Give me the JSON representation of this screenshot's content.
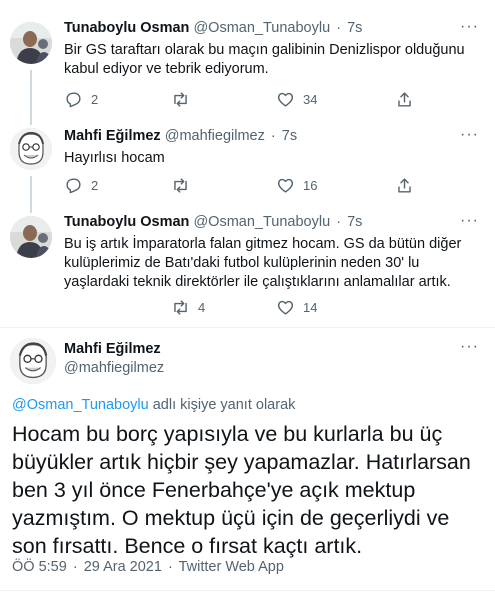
{
  "tweets": [
    {
      "name": "Tunaboylu Osman",
      "handle": "@Osman_Tunaboylu",
      "time": "7s",
      "text": "Bir GS taraftarı olarak bu maçın galibinin Denizlispor olduğunu kabul ediyor ve tebrik ediyorum.",
      "replies": "2",
      "retweets": "",
      "likes": "34"
    },
    {
      "name": "Mahfi Eğilmez",
      "handle": "@mahfiegilmez",
      "time": "7s",
      "text": "Hayırlısı hocam",
      "replies": "2",
      "retweets": "",
      "likes": "16"
    },
    {
      "name": "Tunaboylu Osman",
      "handle": "@Osman_Tunaboylu",
      "time": "7s",
      "text": "Bu iş artık İmparatorla falan gitmez hocam. GS da bütün diğer kulüplerimiz de Batı'daki futbol kulüplerinin neden 30' lu yaşlardaki teknik direktörler ile çalıştıklarını anlamalılar artık.",
      "replies": "",
      "retweets": "4",
      "likes": "14"
    }
  ],
  "main_tweet": {
    "name": "Mahfi Eğilmez",
    "handle": "@mahfiegilmez",
    "reply_to_link": "@Osman_Tunaboylu",
    "reply_to_suffix": "adlı kişiye yanıt olarak",
    "text": "Hocam bu borç yapısıyla ve bu kurlarla bu üç büyükler artık hiçbir şey yapamazlar. Hatırlarsan ben 3 yıl önce Fenerbahçe'ye açık mektup yazmıştım. O mektup üçü için de geçerliydi ve son fırsattı. Bence o fırsat kaçtı artık.",
    "time": "ÖÖ 5:59",
    "date": "29 Ara 2021",
    "app": "Twitter Web App"
  },
  "separator": "·",
  "more_glyph": "···",
  "icons": [
    "reply-icon",
    "retweet-icon",
    "like-icon",
    "share-icon",
    "more-icon"
  ],
  "colors": {
    "link": "#1d9bf0",
    "secondary": "#536471",
    "text": "#0f1419"
  }
}
